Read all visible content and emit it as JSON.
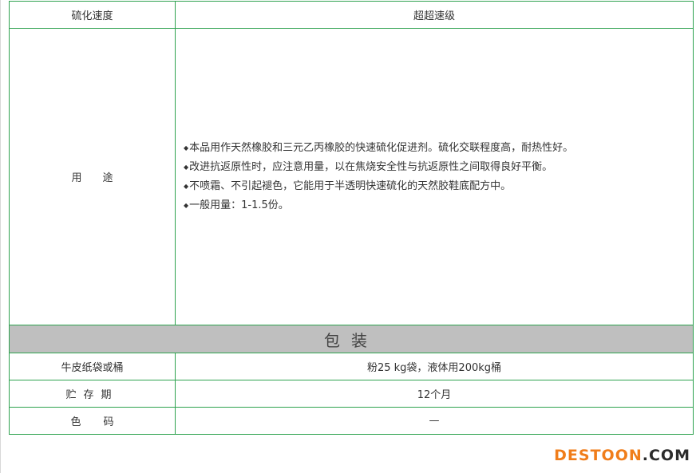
{
  "table": {
    "speed": {
      "label": "硫化速度",
      "value": "超超速级"
    },
    "usage": {
      "label_part1": "用",
      "label_part2": "途",
      "bullet": "◆",
      "items": [
        "本品用作天然橡胶和三元乙丙橡胶的快速硫化促进剂。硫化交联程度高，耐热性好。",
        "改进抗返原性时，应注意用量，以在焦烧安全性与抗返原性之间取得良好平衡。",
        "不喷霜、不引起褪色，它能用于半透明快速硫化的天然胶鞋底配方中。",
        "一般用量：1-1.5份。"
      ]
    },
    "packaging_section": "包装",
    "packaging": {
      "label": "牛皮纸袋或桶",
      "value": "粉25 kg袋，液体用200kg桶"
    },
    "storage": {
      "label": "贮存期",
      "value": "12个月"
    },
    "color": {
      "label_part1": "色",
      "label_part2": "码",
      "value": "—"
    }
  },
  "watermark": {
    "brand": "DESTOON",
    "tld": ".COM"
  },
  "colors": {
    "border": "#2ea24f",
    "section_bg": "#bfbfbf",
    "watermark_brand": "#f07d1a",
    "watermark_tld": "#2b2b2b"
  }
}
